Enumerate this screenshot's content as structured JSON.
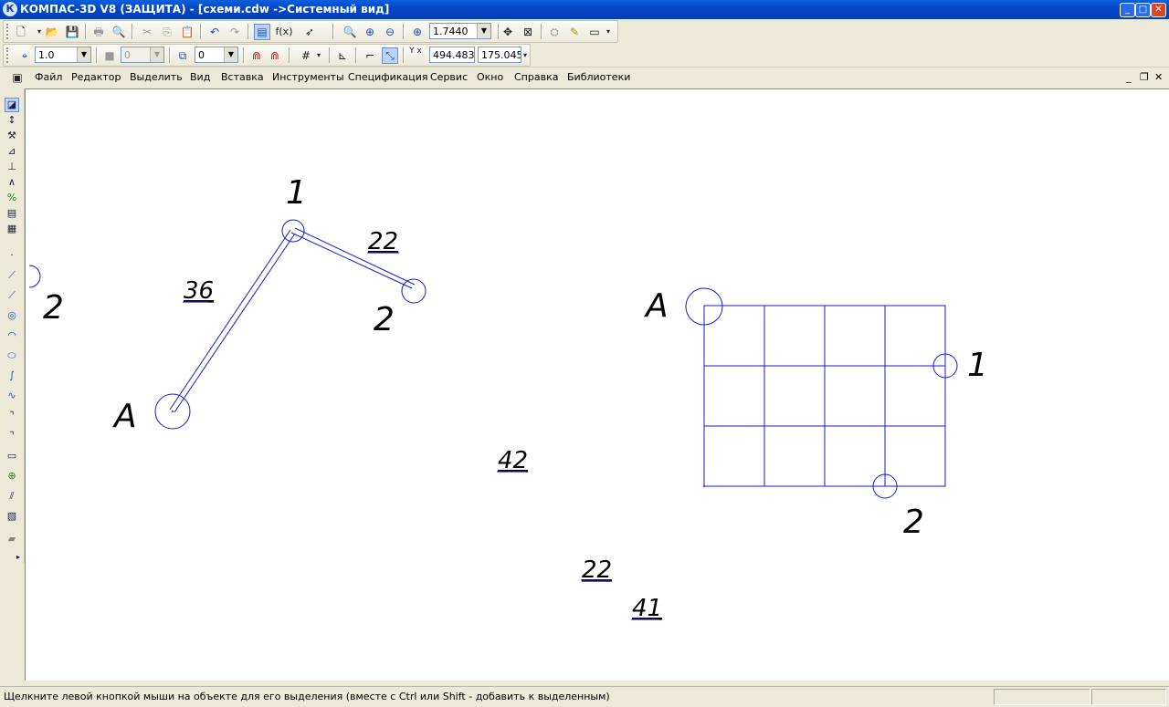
{
  "window": {
    "title": "КОМПАС-3D V8 (ЗАЩИТА) - [схеми.cdw ->Системный вид]",
    "app_icon": "К",
    "buttons": {
      "minimize": "_",
      "maximize": "□",
      "close": "✕"
    }
  },
  "toolbar1": {
    "buttons": [
      "new-icon",
      "open-icon",
      "save-icon",
      "print-icon",
      "preview-icon",
      "cut-icon",
      "copy-icon",
      "paste-icon",
      "undo-icon",
      "redo-icon",
      "manager-icon",
      "function-icon",
      "help-icon",
      "zoom-icon",
      "zoom-in-icon",
      "zoom-out-icon",
      "zoom-scale-icon",
      "pan-icon",
      "zoom-fit-icon",
      "properties-icon",
      "edit-icon",
      "view-icon"
    ],
    "function_label": "f(x)",
    "zoom_value": "1.7440"
  },
  "toolbar2": {
    "step_value": "1.0",
    "style_value": "0",
    "layer_value": "0",
    "coord_label": "Y x",
    "coord_x": "494.483",
    "coord_y": "175.045"
  },
  "menu": {
    "items": [
      "Файл",
      "Редактор",
      "Выделить",
      "Вид",
      "Вставка",
      "Инструменты",
      "Спецификация",
      "Сервис",
      "Окно",
      "Справка",
      "Библиотеки"
    ],
    "mdi_buttons": [
      "_",
      "❐",
      "✕"
    ]
  },
  "left_toolbar": {
    "icons": [
      "geometry-icon",
      "dimensions-icon",
      "symbols-icon",
      "edit-icon",
      "parametrization-icon",
      "measure-icon",
      "select-icon",
      "spec-icon",
      "report-icon",
      "point-icon",
      "line-icon",
      "segment-icon",
      "circle-icon",
      "arc-icon",
      "ellipse-icon",
      "spline-icon",
      "bezier-icon",
      "chamfer-icon",
      "fillet-icon",
      "rectangle-icon",
      "hatch-icon",
      "equidistant-icon",
      "fill-icon",
      "more-icon"
    ]
  },
  "drawing": {
    "colors": {
      "line": "#1a1ad6",
      "text": "#000000"
    },
    "labels": {
      "left_node_1": "1",
      "left_node_2": "2",
      "left_node_a": "A",
      "edge_36": "36",
      "edge_22": "22",
      "edge_2_partial": "2",
      "grid_a": "A",
      "grid_1": "1",
      "grid_2": "2",
      "value_42": "42",
      "value_22": "22",
      "value_41": "41"
    }
  },
  "status": {
    "message": "Щелкните левой кнопкой мыши на объекте для его выделения (вместе с Ctrl или Shift - добавить к выделенным)"
  }
}
